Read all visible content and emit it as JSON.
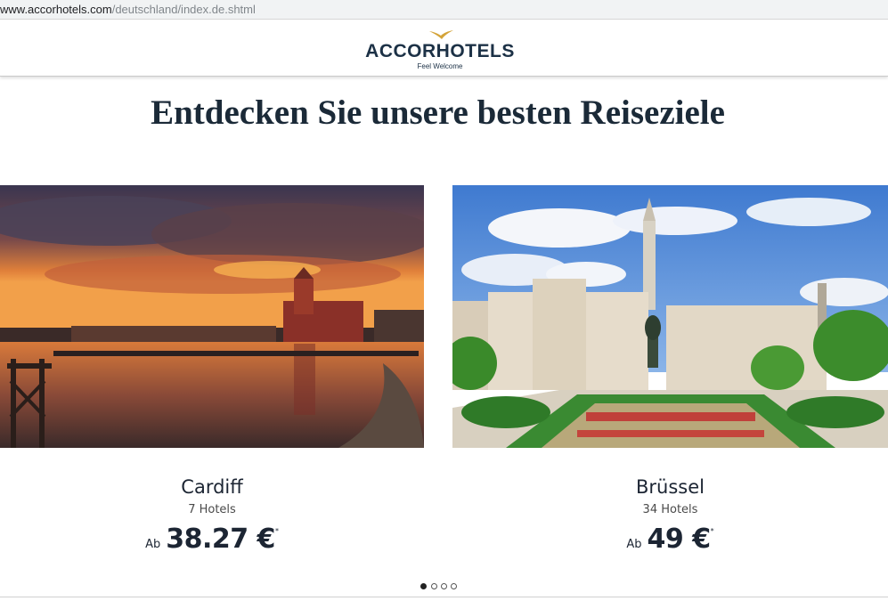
{
  "browser": {
    "url_host": "www.accorhotels.com",
    "url_path": "/deutschland/index.de.shtml"
  },
  "header": {
    "logo_text": "ACCORHOTELS",
    "tagline": "Feel Welcome"
  },
  "main": {
    "headline": "Entdecken Sie unsere besten Reiseziele",
    "destinations": [
      {
        "name": "Cardiff",
        "hotels": "7 Hotels",
        "price_prefix": "Ab",
        "price": "38.27 €",
        "footnote_mark": "*"
      },
      {
        "name": "Brüssel",
        "hotels": "34 Hotels",
        "price_prefix": "Ab",
        "price": "49 €",
        "footnote_mark": "*"
      }
    ],
    "carousel": {
      "pages": 4,
      "active": 1
    }
  },
  "colors": {
    "brand_navy": "#1c3146",
    "brand_gold": "#d4a43a",
    "text_dark": "#1c2533"
  }
}
